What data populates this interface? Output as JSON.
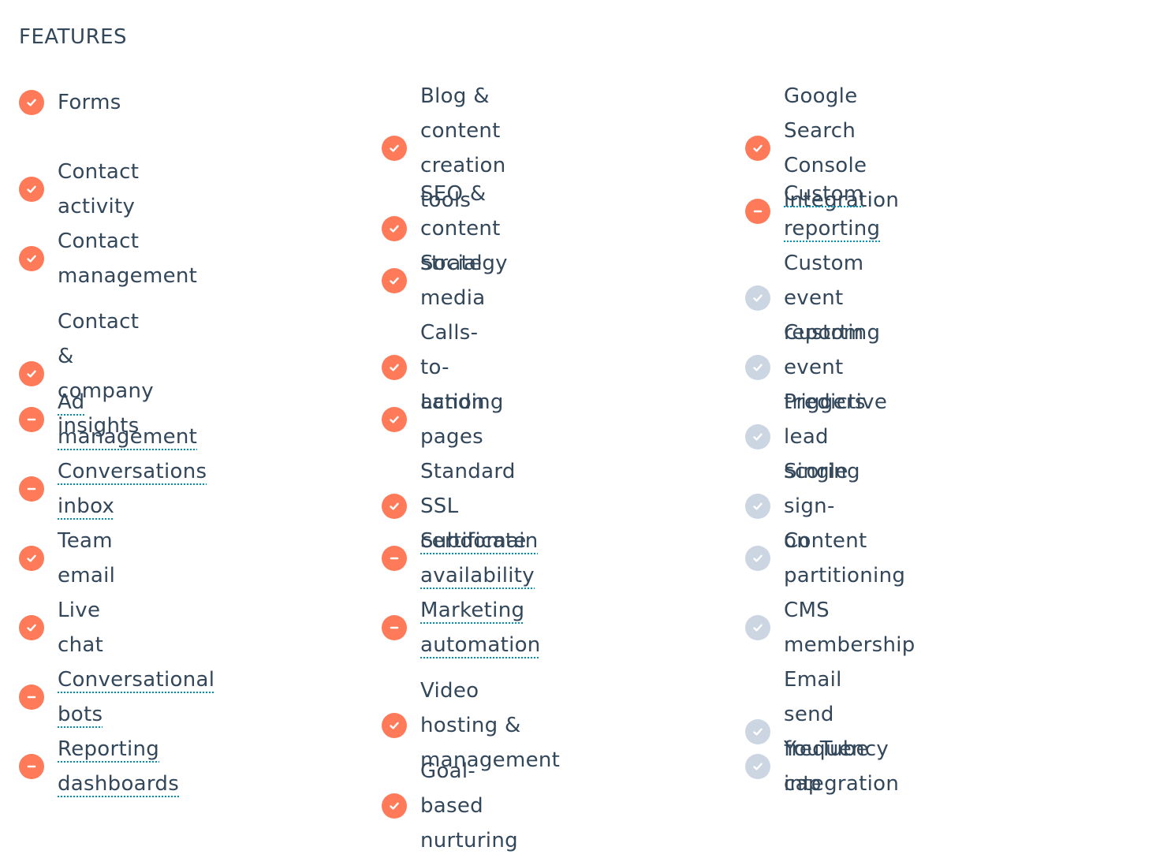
{
  "title": "FEATURES",
  "colors": {
    "check": "#ff7a59",
    "partial": "#ff7a59",
    "none": "#cbd6e2",
    "underline": "#0091ae"
  },
  "columns": [
    [
      {
        "label": "Forms",
        "status": "check",
        "tooltip": false
      },
      {
        "label": "Contact activity",
        "status": "check",
        "tooltip": false
      },
      {
        "label": "Contact management",
        "status": "check",
        "tooltip": false
      },
      {
        "label": "Contact & company insights",
        "status": "check",
        "tooltip": false
      },
      {
        "label": "Ad management",
        "status": "partial",
        "tooltip": true
      },
      {
        "label": "Conversations inbox",
        "status": "partial",
        "tooltip": true
      },
      {
        "label": "Team email",
        "status": "check",
        "tooltip": false
      },
      {
        "label": "Live chat",
        "status": "check",
        "tooltip": false
      },
      {
        "label": "Conversational bots",
        "status": "partial",
        "tooltip": true
      },
      {
        "label": "Reporting dashboards",
        "status": "partial",
        "tooltip": true
      }
    ],
    [
      {
        "label": "Blog & content creation tools",
        "status": "check",
        "tooltip": false
      },
      {
        "label": "SEO & content strategy",
        "status": "check",
        "tooltip": false
      },
      {
        "label": "Social media",
        "status": "check",
        "tooltip": false
      },
      {
        "label": "Calls-to-action",
        "status": "check",
        "tooltip": false
      },
      {
        "label": "Landing pages",
        "status": "check",
        "tooltip": false
      },
      {
        "label": "Standard SSL certificate",
        "status": "check",
        "tooltip": false
      },
      {
        "label": "Subdomain availability",
        "status": "partial",
        "tooltip": true
      },
      {
        "label": "Marketing automation",
        "status": "partial",
        "tooltip": true
      },
      {
        "label": "Video hosting & management",
        "status": "check",
        "tooltip": false
      },
      {
        "label": "Goal-based nurturing",
        "status": "check",
        "tooltip": false
      }
    ],
    [
      {
        "label": "Google Search Console integration",
        "status": "check",
        "tooltip": false
      },
      {
        "label": "Custom reporting",
        "status": "partial",
        "tooltip": true
      },
      {
        "label": "Custom event reporting",
        "status": "none",
        "tooltip": false
      },
      {
        "label": "Custom event triggers",
        "status": "none",
        "tooltip": false
      },
      {
        "label": "Predictive lead scoring",
        "status": "none",
        "tooltip": false
      },
      {
        "label": "Single sign-on",
        "status": "none",
        "tooltip": false
      },
      {
        "label": "Content partitioning",
        "status": "none",
        "tooltip": false
      },
      {
        "label": "CMS membership",
        "status": "none",
        "tooltip": false
      },
      {
        "label": "Email send frequency cap",
        "status": "none",
        "tooltip": false
      },
      {
        "label": "YouTube integration",
        "status": "none",
        "tooltip": false
      }
    ]
  ]
}
